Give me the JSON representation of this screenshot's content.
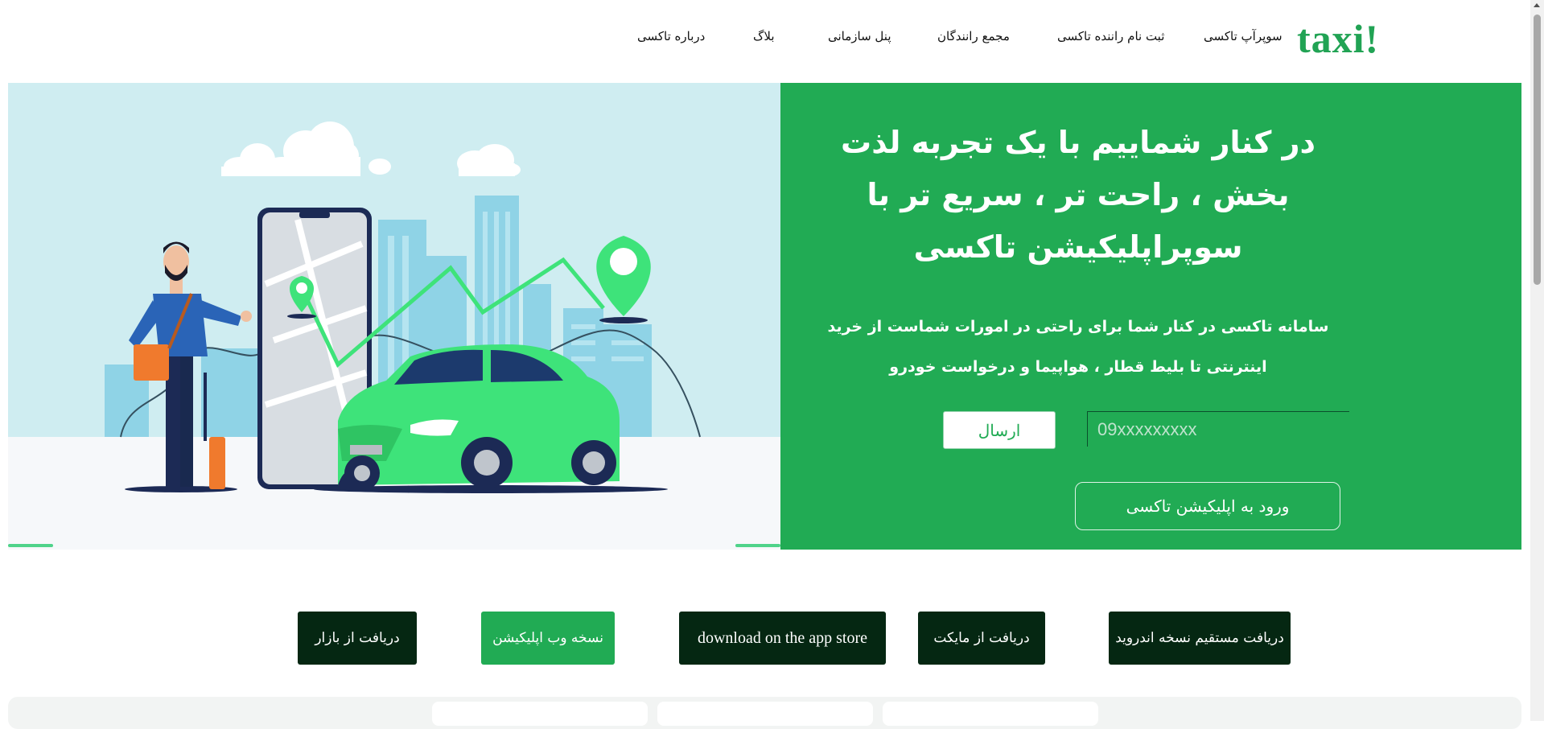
{
  "logo": "taxi!",
  "nav": {
    "super_app": "سوپرآپ تاکسی",
    "driver_signup": "ثبت نام راننده تاکسی",
    "drivers_forum": "مجمع رانندگان",
    "org_panel": "پنل سازمانی",
    "blog": "بلاگ",
    "about": "درباره تاکسی"
  },
  "hero": {
    "title": "در کنار شماییم با یک تجربه لذت بخش ، راحت تر ، سریع تر با سوپراپلیکیشن تاکسی",
    "subtitle": "سامانه تاکسی در کنار شما برای راحتی در امورات شماست از خرید اینترنتی تا بلیط قطار ، هواپیما و درخواست خودرو",
    "phone_placeholder": "09xxxxxxxxx",
    "send_label": "ارسال",
    "enter_app_label": "ورود به اپلیکیشن تاکسی"
  },
  "downloads": {
    "direct_android": "دریافت مستقیم نسخه اندروید",
    "myket": "دریافت از مایکت",
    "app_store": "download on the app store",
    "web_version": "نسخه وب اپلیکیشن",
    "bazaar": "دریافت از بازار"
  },
  "colors": {
    "brand_green": "#21ab54",
    "dark_green": "#052712",
    "sky": "#cfedf1",
    "car_green": "#3ee37a"
  }
}
